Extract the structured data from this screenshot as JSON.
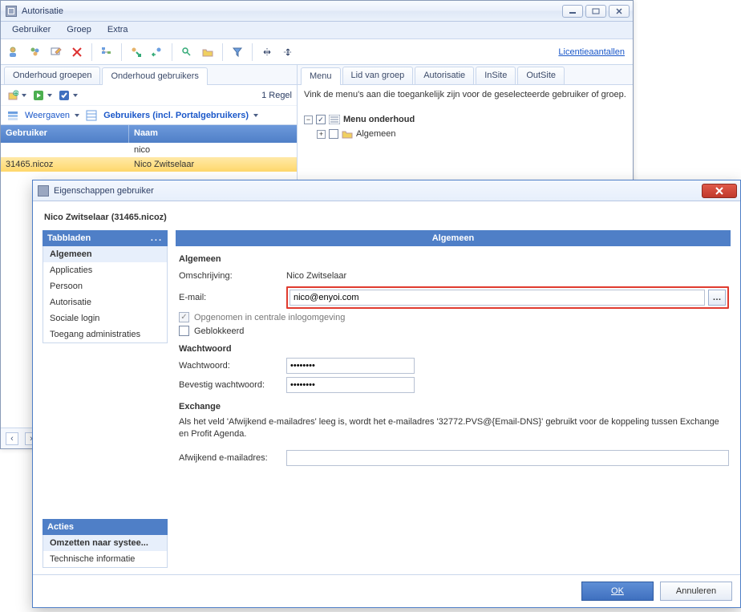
{
  "win1": {
    "title": "Autorisatie",
    "menubar": [
      "Gebruiker",
      "Groep",
      "Extra"
    ],
    "toolbar_link": "Licentieaantallen",
    "left_tabs": [
      "Onderhoud groepen",
      "Onderhoud gebruikers"
    ],
    "left_active_tab": 1,
    "regel_count": "1 Regel",
    "weergaven_label": "Weergaven",
    "view_dropdown": "Gebruikers (incl. Portalgebruikers)",
    "grid_headers": {
      "a": "Gebruiker",
      "b": "Naam"
    },
    "grid_rows": [
      {
        "a": "",
        "b": "nico",
        "selected": false
      },
      {
        "a": "31465.nicoz",
        "b": "Nico Zwitselaar",
        "selected": true
      }
    ],
    "right_tabs": [
      "Menu",
      "Lid van groep",
      "Autorisatie",
      "InSite",
      "OutSite"
    ],
    "right_active_tab": 0,
    "right_help": "Vink de menu's aan die toegankelijk zijn voor de geselecteerde gebruiker of groep.",
    "tree": {
      "root": {
        "expander": "−",
        "checked": true,
        "label": "Menu onderhoud"
      },
      "child": {
        "expander": "+",
        "checked": false,
        "label": "Algemeen"
      }
    }
  },
  "win2": {
    "title": "Eigenschappen gebruiker",
    "person_line": "Nico Zwitselaar (31465.nicoz)",
    "side_header": "Tabbladen",
    "side_items": [
      "Algemeen",
      "Applicaties",
      "Persoon",
      "Autorisatie",
      "Sociale login",
      "Toegang administraties"
    ],
    "side_active": 0,
    "actions_header": "Acties",
    "actions_items": [
      "Omzetten naar systee...",
      "Technische informatie"
    ],
    "actions_active": 0,
    "content_header": "Algemeen",
    "groups": {
      "algemeen": {
        "title": "Algemeen",
        "omschrijving_label": "Omschrijving:",
        "omschrijving_value": "Nico Zwitselaar",
        "email_label": "E-mail:",
        "email_value": "nico@enyoi.com",
        "opgenomen_label": "Opgenomen in centrale inlogomgeving",
        "opgenomen_checked": true,
        "geblokkeerd_label": "Geblokkeerd",
        "geblokkeerd_checked": false
      },
      "wachtwoord": {
        "title": "Wachtwoord",
        "ww_label": "Wachtwoord:",
        "ww_value": "xxxxxxxx",
        "bev_label": "Bevestig wachtwoord:",
        "bev_value": "xxxxxxxx"
      },
      "exchange": {
        "title": "Exchange",
        "note": "Als het veld 'Afwijkend e-mailadres' leeg is, wordt het e-mailadres '32772.PVS@{Email-DNS}' gebruikt voor de koppeling tussen Exchange en Profit Agenda.",
        "afw_label": "Afwijkend e-mailadres:",
        "afw_value": ""
      }
    },
    "ok_label": "OK",
    "cancel_label": "Annuleren"
  }
}
